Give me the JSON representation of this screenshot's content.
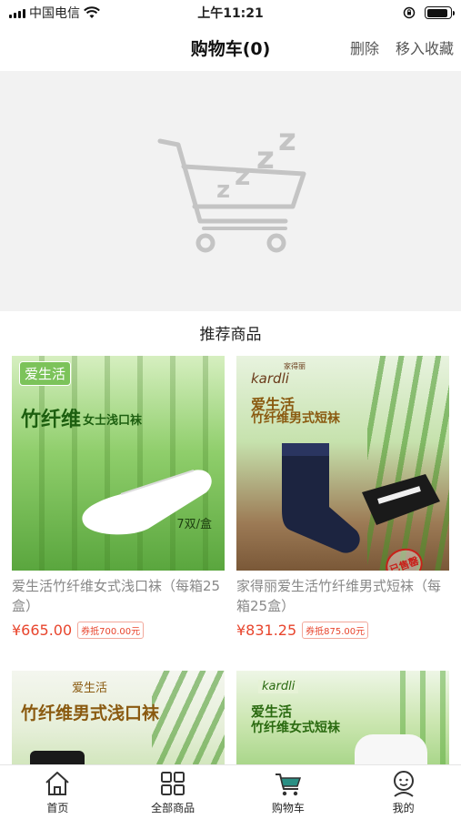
{
  "status_bar": {
    "carrier": "中国电信",
    "time": "上午11:21",
    "battery_level": 0.9
  },
  "nav": {
    "title": "购物车(0)",
    "delete_label": "删除",
    "move_to_favorites_label": "移入收藏"
  },
  "empty_cart": {
    "icon": "sleeping-cart-icon",
    "zzz_text": "zzz"
  },
  "recommend": {
    "title": "推荐商品",
    "products": [
      {
        "name": "爱生活竹纤维女式浅口袜（每箱25盒）",
        "price": "¥665.00",
        "coupon": "券抵700.00元",
        "image_brand": "爱生活",
        "image_headline": "竹纤维",
        "image_subheadline": "女士浅口袜",
        "image_count": "7双/盒"
      },
      {
        "name": "家得丽爱生活竹纤维男式短袜（每箱25盒）",
        "price": "¥831.25",
        "coupon": "券抵875.00元",
        "image_brand": "kardli",
        "image_brand_cn": "家得丽",
        "image_headline": "爱生活",
        "image_subheadline": "竹纤维男式短袜",
        "image_stamp": "已售罄"
      },
      {
        "image_brand": "爱生活",
        "image_headline": "竹纤维男式浅口袜"
      },
      {
        "image_brand": "kardli",
        "image_headline": "爱生活",
        "image_subheadline": "竹纤维女式短袜"
      }
    ]
  },
  "tab_bar": {
    "tabs": [
      {
        "label": "首页",
        "icon": "home-icon"
      },
      {
        "label": "全部商品",
        "icon": "grid-icon"
      },
      {
        "label": "购物车",
        "icon": "cart-icon"
      },
      {
        "label": "我的",
        "icon": "user-icon"
      }
    ]
  },
  "colors": {
    "accent_red": "#e8452d",
    "cart_gray": "#c4c4c4",
    "tab_active": "#2a8f84"
  }
}
